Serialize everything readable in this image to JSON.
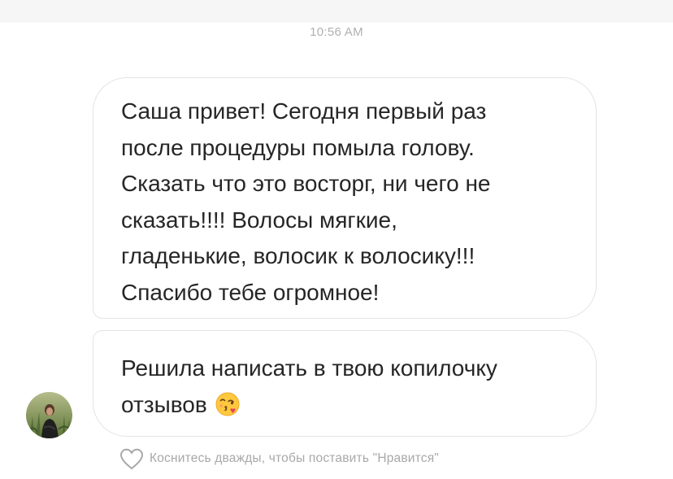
{
  "timestamp": "10:56 AM",
  "messages": [
    {
      "lines": [
        "Саша привет! Сегодня первый раз",
        "после процедуры помыла голову.",
        "Сказать что это восторг, ни чего не",
        "сказать!!!! Волосы мягкие,",
        "гладенькие, волосик к волосику!!!",
        "Спасибо тебе огромное!"
      ]
    },
    {
      "lines": [
        "Решила написать в твою копилочку",
        "отзывов"
      ],
      "emoji": "face-throwing-kiss-icon"
    }
  ],
  "like_hint": "Коснитесь дважды, чтобы поставить \"Нравится\"",
  "colors": {
    "bubble_border": "#e4e4e4",
    "text": "#262626",
    "muted": "#a8a8a8",
    "emoji_face": "#ffc83d",
    "kiss_heart": "#e8435a"
  }
}
